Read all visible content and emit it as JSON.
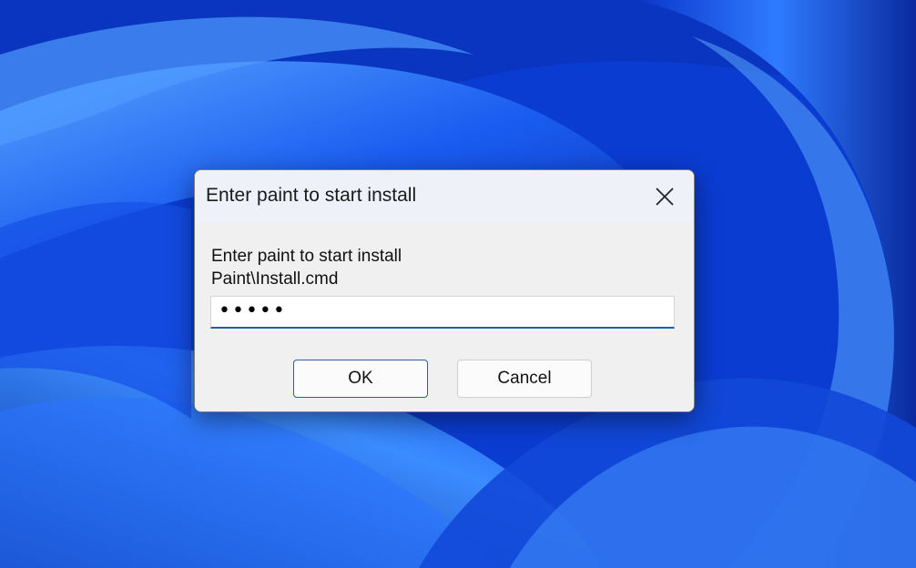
{
  "window": {
    "title": "Enter paint to start install",
    "close_icon": "close-icon"
  },
  "prompt": {
    "line1": "Enter paint to start install",
    "line2": "Paint\\Install.cmd"
  },
  "input": {
    "value": "•••••"
  },
  "buttons": {
    "ok_label": "OK",
    "cancel_label": "Cancel"
  },
  "colors": {
    "wallpaper_base": "#0a3fd6",
    "accent": "#1f5fa8",
    "dialog_bg": "#f0f0f0",
    "titlebar_bg": "#eef2f8"
  }
}
